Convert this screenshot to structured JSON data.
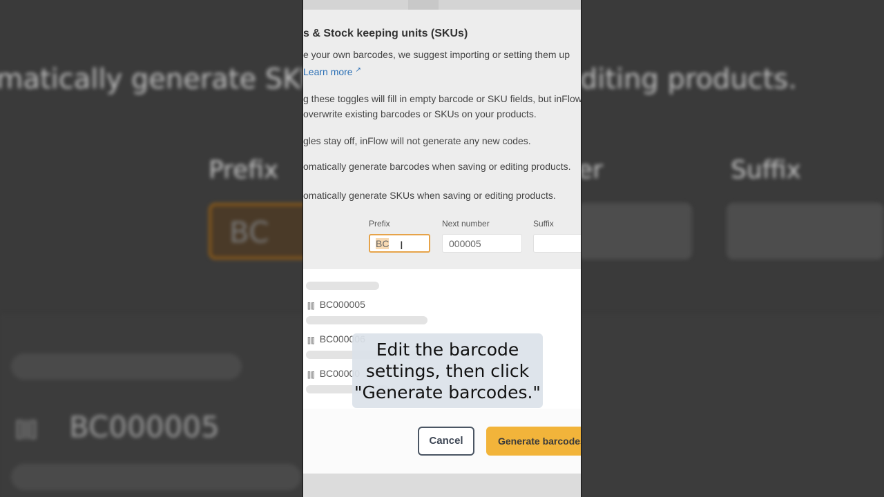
{
  "background": {
    "heading_fragment": "omatically generate SKUs when saving or editing products.",
    "label_prefix": "Prefix",
    "label_next": "er",
    "label_suffix": "Suffix",
    "prefix_value": "BC",
    "code_value": "BC000005"
  },
  "dialog": {
    "title": "s & Stock keeping units (SKUs)",
    "intro_line1": "e your own barcodes, we suggest importing or setting them up",
    "learn_more": "Learn more",
    "note_line1": "g these toggles will fill in empty barcode or SKU fields, but inFlow",
    "note_line2": "overwrite existing barcodes or SKUs on your products.",
    "note_off": "gles stay off, inFlow will not generate any new codes.",
    "toggle_barcodes": "omatically generate barcodes when saving or editing products.",
    "toggle_skus": "omatically generate SKUs when saving or editing products.",
    "fields": {
      "prefix_label": "Prefix",
      "prefix_value": "BC",
      "next_label": "Next number",
      "next_value": "000005",
      "suffix_label": "Suffix",
      "suffix_value": ""
    },
    "preview_codes": [
      "BC000005",
      "BC000006",
      "BC00000"
    ],
    "cancel_label": "Cancel",
    "generate_label": "Generate barcodes"
  },
  "caption": {
    "line1": "Edit the barcode",
    "line2": "settings, then click",
    "line3": "\"Generate barcodes.\""
  },
  "colors": {
    "accent": "#f2b43a",
    "prefix_border": "#e6a349",
    "link": "#2a6fb5"
  }
}
